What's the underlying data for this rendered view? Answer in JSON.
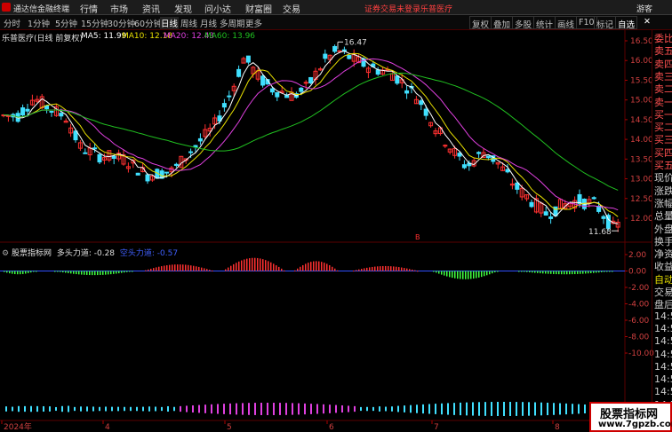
{
  "app": {
    "name": "通达信金融终端"
  },
  "menus": [
    "行情",
    "市场",
    "资讯",
    "发现",
    "问小达",
    "财富圈",
    "交易"
  ],
  "status_warning": "证券交易未登录",
  "stock_name": "乐普医疗",
  "user_label": "游客",
  "toolbar": {
    "timeframes": [
      "分时",
      "1分钟",
      "5分钟",
      "15分钟",
      "30分钟",
      "60分钟",
      "日线",
      "周线",
      "月线",
      "多周期",
      "更多"
    ],
    "active_timeframe": "日线",
    "buttons": [
      "复权",
      "叠加",
      "多股",
      "统计",
      "画线",
      "F10",
      "标记",
      "自选"
    ]
  },
  "main_chart": {
    "title": "乐普医疗(日线 前复权)",
    "ma": [
      {
        "label": "MA5: 11.99",
        "color": "#ffffff"
      },
      {
        "label": "MA10: 12.18",
        "color": "#e8e000"
      },
      {
        "label": "MA20: 12.43",
        "color": "#e040e0"
      },
      {
        "label": "MA60: 13.96",
        "color": "#20c020"
      }
    ],
    "y_ticks": [
      "16.50",
      "16.00",
      "15.50",
      "15.00",
      "14.50",
      "14.00",
      "13.50",
      "13.00",
      "12.50",
      "12.00"
    ],
    "high_label": "16.47",
    "low_label": "11.68",
    "marker": "B"
  },
  "indicator": {
    "title": "股票指标网",
    "line1": "多头力道: -0.28",
    "line2": "空头力道: -0.57",
    "y_ticks": [
      "2.00",
      "0.00",
      "-2.00",
      "-4.00",
      "-6.00",
      "-8.00",
      "-10.00"
    ]
  },
  "x_labels": [
    "2024年",
    "4",
    "5",
    "6",
    "7",
    "8"
  ],
  "right_panel": [
    {
      "text": "委比",
      "color": "#ff5050"
    },
    {
      "text": "卖五",
      "color": "#ff5050"
    },
    {
      "text": "卖四",
      "color": "#ff5050"
    },
    {
      "text": "卖三",
      "color": "#ff5050"
    },
    {
      "text": "卖二",
      "color": "#ff5050"
    },
    {
      "text": "卖一",
      "color": "#ff5050"
    },
    {
      "text": "买一",
      "color": "#ff5050"
    },
    {
      "text": "买二",
      "color": "#ff5050"
    },
    {
      "text": "买三",
      "color": "#ff5050"
    },
    {
      "text": "买四",
      "color": "#ff5050"
    },
    {
      "text": "买五",
      "color": "#ff5050"
    },
    {
      "text": "现价",
      "color": "#cccccc"
    },
    {
      "text": "涨跌",
      "color": "#cccccc"
    },
    {
      "text": "涨幅",
      "color": "#cccccc"
    },
    {
      "text": "总量",
      "color": "#cccccc"
    },
    {
      "text": "外盘",
      "color": "#cccccc"
    },
    {
      "text": "换手",
      "color": "#cccccc"
    },
    {
      "text": "净资",
      "color": "#cccccc"
    },
    {
      "text": "收益",
      "color": "#cccccc"
    },
    {
      "text": "自动",
      "color": "#e8e000"
    },
    {
      "text": "交易",
      "color": "#cccccc"
    },
    {
      "text": "盘后",
      "color": "#cccccc"
    },
    {
      "text": "14:5",
      "color": "#cccccc"
    },
    {
      "text": "14:5",
      "color": "#cccccc"
    },
    {
      "text": "14:5",
      "color": "#cccccc"
    },
    {
      "text": "14:5",
      "color": "#cccccc"
    },
    {
      "text": "14:5",
      "color": "#cccccc"
    },
    {
      "text": "14:5",
      "color": "#cccccc"
    },
    {
      "text": "14:5",
      "color": "#cccccc"
    },
    {
      "text": "14:5",
      "color": "#cccccc"
    }
  ],
  "watermark": {
    "name": "股票指标网",
    "url": "www.7gpzb.com"
  },
  "colors": {
    "up": "#ff3030",
    "down": "#40e0ff",
    "ma5": "#ffffff",
    "ma10": "#e8e000",
    "ma20": "#e040e0",
    "ma60": "#20c020",
    "bull_bar": "#ff3030",
    "bear_bar": "#40ff40",
    "magenta_bar": "#e040e0",
    "cyan_bar": "#40e0ff"
  }
}
